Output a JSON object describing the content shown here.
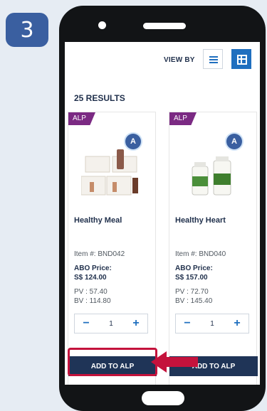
{
  "step_number": "3",
  "toolbar": {
    "view_by_label": "VIEW BY"
  },
  "results_count": "25 RESULTS",
  "products": [
    {
      "tag": "ALP",
      "name": "Healthy Meal",
      "item": "Item #: BND042",
      "abo_label": "ABO Price:",
      "abo_price": "S$ 124.00",
      "pv": "PV : 57.40",
      "bv": "BV : 114.80",
      "qty": "1",
      "add_label": "ADD TO ALP"
    },
    {
      "tag": "ALP",
      "name": "Healthy Heart",
      "item": "Item #: BND040",
      "abo_label": "ABO Price:",
      "abo_price": "S$ 157.00",
      "pv": "PV : 72.70",
      "bv": "BV : 145.40",
      "qty": "1",
      "add_label": "ADD TO ALP"
    }
  ],
  "colors": {
    "accent": "#1f6fbf",
    "button": "#1f3457",
    "highlight": "#c4123c",
    "tag": "#7b2a83"
  },
  "icons": [
    "list-view-icon",
    "grid-view-icon",
    "minus-icon",
    "plus-icon",
    "subscription-icon",
    "arrow-icon"
  ]
}
